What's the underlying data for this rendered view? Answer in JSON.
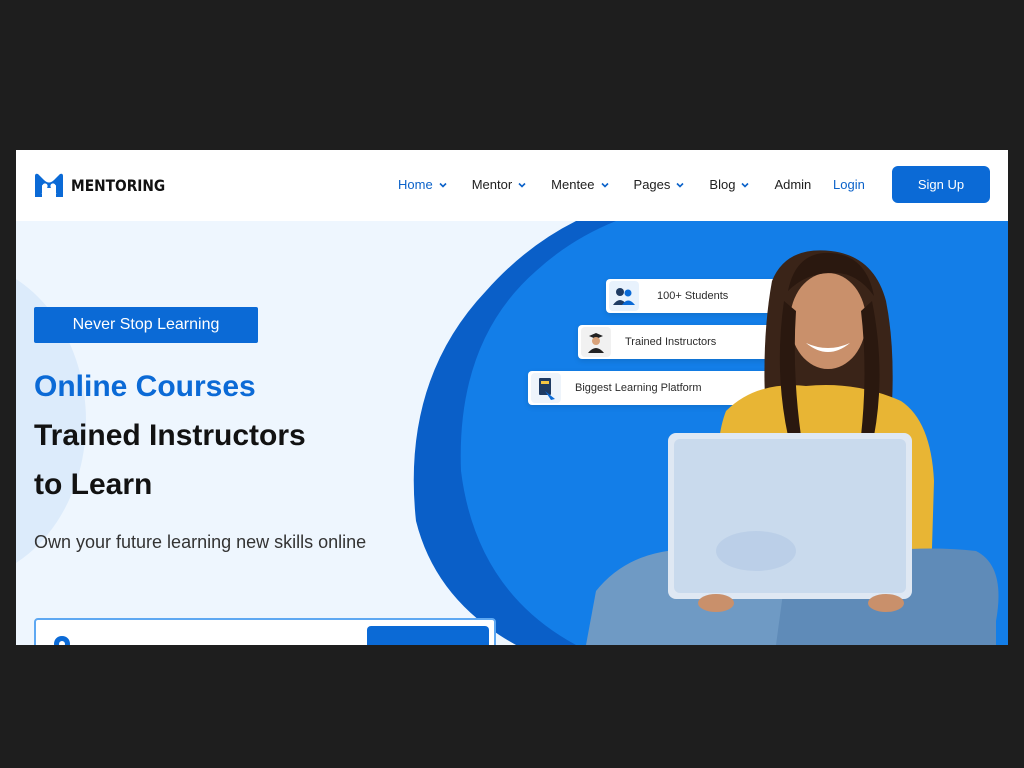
{
  "brand": {
    "name": "MENTORING",
    "logo_icon": "mentoring-logo-icon",
    "color": "#0b6ad6"
  },
  "nav": {
    "items": [
      {
        "label": "Home",
        "has_dropdown": true,
        "active": true
      },
      {
        "label": "Mentor",
        "has_dropdown": true,
        "active": false
      },
      {
        "label": "Mentee",
        "has_dropdown": true,
        "active": false
      },
      {
        "label": "Pages",
        "has_dropdown": true,
        "active": false
      },
      {
        "label": "Blog",
        "has_dropdown": true,
        "active": false
      },
      {
        "label": "Admin",
        "has_dropdown": false,
        "active": false
      }
    ],
    "login_label": "Login",
    "signup_label": "Sign Up"
  },
  "hero": {
    "badge": "Never Stop Learning",
    "headline_1": "Online Courses",
    "headline_2": "Trained Instructors",
    "headline_3": "to Learn",
    "subtitle": "Own your future learning new skills online",
    "search": {
      "placeholder": "",
      "icon": "location-pin-icon"
    },
    "features": [
      {
        "label": "100+ Students",
        "icon": "students-icon"
      },
      {
        "label": "Trained Instructors",
        "icon": "graduate-icon"
      },
      {
        "label": "Biggest Learning Platform",
        "icon": "book-icon"
      }
    ],
    "image": "woman-with-laptop-photo"
  },
  "colors": {
    "accent": "#0b6ad6",
    "hero_background": "#eef6fe",
    "blob_blue": "#0b6ad6",
    "page_frame": "#1e1e1e"
  }
}
